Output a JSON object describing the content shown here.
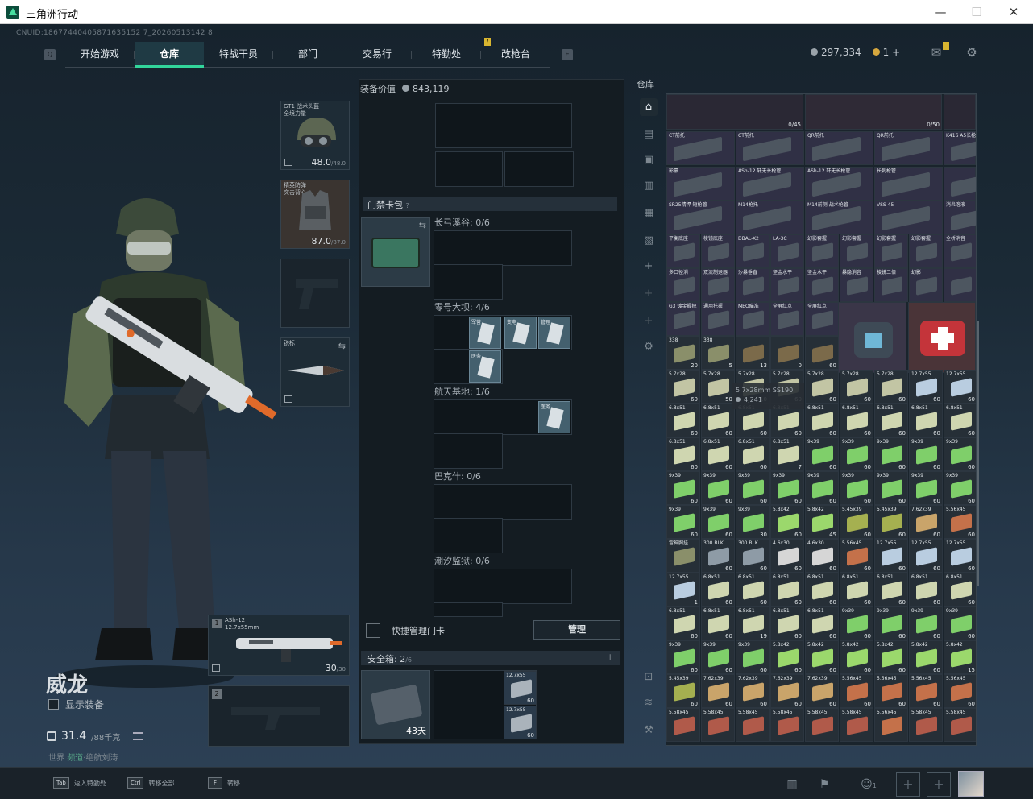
{
  "window": {
    "title": "三角洲行动",
    "controls": [
      "—",
      "☐",
      "✕"
    ]
  },
  "cnuid": "CNUID:18677440405871635152 7_20260513142 8",
  "nav": {
    "left_key": "Q",
    "right_key": "E",
    "tabs": [
      {
        "label": "开始游戏",
        "active": false
      },
      {
        "label": "仓库",
        "active": true
      },
      {
        "label": "特战干员",
        "active": false
      },
      {
        "label": "部门",
        "active": false
      },
      {
        "label": "交易行",
        "active": false
      },
      {
        "label": "特勤处",
        "active": false,
        "badge": "!"
      },
      {
        "label": "改枪台",
        "active": false
      }
    ]
  },
  "currency": {
    "silver": "297,334",
    "gold": "1",
    "plus": "+"
  },
  "character": {
    "name": "威龙",
    "show_equipment": "显示装备",
    "weight": "31.4",
    "weight_max": "/88千克",
    "region_prefix": "世界 ",
    "region_status": "频道",
    "region_suffix": "·绝航刘涛"
  },
  "slots": {
    "helmet": {
      "name": "GT1 战术头盔",
      "sub": "全境力量",
      "value": "48.0",
      "max": "/48.0"
    },
    "armor": {
      "name": "精英防弹",
      "sub": "突击背心",
      "value": "87.0",
      "max": "/87.0"
    },
    "melee": {
      "name": "锐标"
    },
    "primary": {
      "num": "1",
      "name": "ASh-12",
      "sub": "12.7x55mm",
      "ammo": "30",
      "ammo_max": "/30"
    },
    "secondary": {
      "num": "2"
    }
  },
  "middle": {
    "equip_value_label": "装备价值",
    "equip_value": "843,119",
    "keycard_section": "门禁卡包",
    "keycard_help": "?",
    "maps": [
      {
        "label": "长弓溪谷: 0/6",
        "cards": []
      },
      {
        "label": "零号大坝: 4/6",
        "cards": [
          "军营",
          "变电",
          "管理",
          "医务"
        ]
      },
      {
        "label": "航天基地: 1/6",
        "cards": [
          "医务"
        ]
      },
      {
        "label": "巴克什: 0/6",
        "cards": []
      },
      {
        "label": "潮汐监狱: 0/6",
        "cards": []
      }
    ],
    "quick_manage": "快捷管理门卡",
    "manage_btn": "管理",
    "safebox_label": "安全箱: ",
    "safebox_count": "2",
    "safebox_max": "/6",
    "safe_days": "43天",
    "safe_items": [
      {
        "t": "12.7x55",
        "c": "60"
      },
      {
        "t": "12.7x55",
        "c": "60"
      }
    ]
  },
  "warehouse": {
    "label": "仓库",
    "tooltip_title": "5.7x28mm SS190",
    "tooltip_price": "4,241",
    "top_counts": [
      "0/45",
      "0/50"
    ],
    "rows": [
      [
        [
          "CT前托",
          ""
        ],
        [
          "CT前托",
          ""
        ],
        [
          "QR前托",
          ""
        ],
        [
          "QR前托",
          ""
        ],
        [
          "K416 A5长枪管",
          ""
        ]
      ],
      [
        [
          "影豪",
          ""
        ],
        [
          "ASh-12 轩无长枪管",
          ""
        ],
        [
          "ASh-12 轩无长枪管",
          ""
        ],
        [
          "长刺枪管",
          ""
        ],
        [
          "",
          ""
        ]
      ],
      [
        [
          "SR25精悍 短枪管",
          ""
        ],
        [
          "M14枪托",
          ""
        ],
        [
          "M14前侧 战术枪管",
          ""
        ],
        [
          "VSS 45",
          ""
        ],
        [
          "消炎溶液",
          ""
        ]
      ],
      [
        [
          "平衡底座",
          ""
        ],
        [
          "棱镜底座",
          ""
        ],
        [
          "DBAL-X2",
          ""
        ],
        [
          "LA-3C",
          ""
        ],
        [
          "幻影套握",
          ""
        ],
        [
          "幻影套握",
          ""
        ],
        [
          "幻影套握",
          ""
        ],
        [
          "幻影套握",
          ""
        ],
        [
          "全桥消音",
          ""
        ]
      ],
      [
        [
          "多口径消",
          ""
        ],
        [
          "双流制退器",
          ""
        ],
        [
          "沙暴垂直",
          ""
        ],
        [
          "坚金水平",
          ""
        ],
        [
          "坚金水平",
          ""
        ],
        [
          "暴隐消音",
          ""
        ],
        [
          "棱镜二倍",
          ""
        ],
        [
          "幻影",
          ""
        ],
        [
          "",
          ""
        ]
      ],
      [
        [
          "G3 镀金握把",
          ""
        ],
        [
          "通用托握",
          ""
        ],
        [
          "MEO瞄准",
          ""
        ],
        [
          "全屏红点",
          ""
        ],
        [
          "全屏红点",
          ""
        ]
      ],
      [
        [
          "338",
          "20"
        ],
        [
          "338",
          "5"
        ],
        [
          "",
          "13"
        ],
        [
          "",
          "0"
        ],
        [
          "",
          "60"
        ],
        [
          "",
          "120"
        ],
        [
          "",
          "800"
        ]
      ],
      [
        [
          "5.7x28",
          "60"
        ],
        [
          "5.7x28",
          "50"
        ],
        [
          "5.7x28",
          "10"
        ],
        [
          "5.7x28",
          "60"
        ],
        [
          "5.7x28",
          "60"
        ],
        [
          "5.7x28",
          "60"
        ],
        [
          "5.7x28",
          "60"
        ],
        [
          "12.7x55",
          "60"
        ],
        [
          "12.7x55",
          "60"
        ],
        [
          "12.7x55",
          "20"
        ]
      ]
    ],
    "ammo_rows": [
      [
        [
          "6.8x51",
          "60"
        ],
        [
          "6.8x51",
          "60"
        ],
        [
          "6.8x51",
          "60"
        ],
        [
          "6.8x51",
          "60"
        ],
        [
          "6.8x51",
          "60"
        ],
        [
          "6.8x51",
          "60"
        ],
        [
          "6.8x51",
          "60"
        ],
        [
          "6.8x51",
          "60"
        ],
        [
          "6.8x51",
          "60"
        ]
      ],
      [
        [
          "6.8x51",
          "60"
        ],
        [
          "6.8x51",
          "60"
        ],
        [
          "6.8x51",
          "60"
        ],
        [
          "6.8x51",
          "7"
        ],
        [
          "9x39",
          "60"
        ],
        [
          "9x39",
          "60"
        ],
        [
          "9x39",
          "60"
        ],
        [
          "9x39",
          "60"
        ],
        [
          "9x39",
          "60"
        ]
      ],
      [
        [
          "9x39",
          "60"
        ],
        [
          "9x39",
          "60"
        ],
        [
          "9x39",
          "60"
        ],
        [
          "9x39",
          "60"
        ],
        [
          "9x39",
          "60"
        ],
        [
          "9x39",
          "60"
        ],
        [
          "9x39",
          "60"
        ],
        [
          "9x39",
          "60"
        ],
        [
          "9x39",
          "60"
        ]
      ],
      [
        [
          "9x39",
          "60"
        ],
        [
          "9x39",
          "60"
        ],
        [
          "9x39",
          "30"
        ],
        [
          "5.8x42",
          "60"
        ],
        [
          "5.8x42",
          "45"
        ],
        [
          "5.45x39",
          "60"
        ],
        [
          "5.45x39",
          "60"
        ],
        [
          "7.62x39",
          "60"
        ],
        [
          "5.56x45",
          "60"
        ]
      ],
      [
        [
          "雷神胸挂",
          ""
        ],
        [
          "300 BLK",
          "60"
        ],
        [
          "300 BLK",
          "60"
        ],
        [
          "4.6x30",
          "60"
        ],
        [
          "4.6x30",
          "60"
        ],
        [
          "5.56x45",
          "60"
        ],
        [
          "12.7x55",
          "60"
        ],
        [
          "12.7x55",
          "60"
        ],
        [
          "12.7x55",
          "60"
        ]
      ],
      [
        [
          "12.7x55",
          "1"
        ],
        [
          "6.8x51",
          "60"
        ],
        [
          "6.8x51",
          "60"
        ],
        [
          "6.8x51",
          "60"
        ],
        [
          "6.8x51",
          "60"
        ],
        [
          "6.8x51",
          "60"
        ],
        [
          "6.8x51",
          "60"
        ],
        [
          "6.8x51",
          "60"
        ],
        [
          "6.8x51",
          "60"
        ]
      ],
      [
        [
          "6.8x51",
          "60"
        ],
        [
          "6.8x51",
          "60"
        ],
        [
          "6.8x51",
          "19"
        ],
        [
          "6.8x51",
          "60"
        ],
        [
          "6.8x51",
          "60"
        ],
        [
          "9x39",
          "60"
        ],
        [
          "9x39",
          "60"
        ],
        [
          "9x39",
          "60"
        ],
        [
          "9x39",
          "60"
        ]
      ],
      [
        [
          "9x39",
          "60"
        ],
        [
          "9x39",
          "60"
        ],
        [
          "9x39",
          "60"
        ],
        [
          "5.8x42",
          "60"
        ],
        [
          "5.8x42",
          "60"
        ],
        [
          "5.8x42",
          "60"
        ],
        [
          "5.8x42",
          "60"
        ],
        [
          "5.8x42",
          "60"
        ],
        [
          "5.8x42",
          "15"
        ]
      ],
      [
        [
          "5.45x39",
          "60"
        ],
        [
          "7.62x39",
          "60"
        ],
        [
          "7.62x39",
          "60"
        ],
        [
          "7.62x39",
          "60"
        ],
        [
          "7.62x39",
          "60"
        ],
        [
          "5.56x45",
          "60"
        ],
        [
          "5.56x45",
          "60"
        ],
        [
          "5.56x45",
          "60"
        ],
        [
          "5.56x45",
          "60"
        ]
      ],
      [
        [
          "5.58x45",
          ""
        ],
        [
          "5.58x45",
          ""
        ],
        [
          "5.58x45",
          ""
        ],
        [
          "5.58x45",
          ""
        ],
        [
          "5.58x45",
          ""
        ],
        [
          "5.58x45",
          ""
        ],
        [
          "5.56x45",
          ""
        ],
        [
          "5.58x45",
          ""
        ],
        [
          "5.58x45",
          ""
        ]
      ]
    ]
  },
  "bottom": {
    "keys": [
      {
        "k": "Tab",
        "t": "返入特勤处"
      },
      {
        "k": "Ctrl",
        "t": "转移全部"
      },
      {
        "k": "F",
        "t": "转移"
      }
    ],
    "friends": "1"
  },
  "colors": {
    "accent": "#32d59b",
    "badge": "#d8b530"
  }
}
